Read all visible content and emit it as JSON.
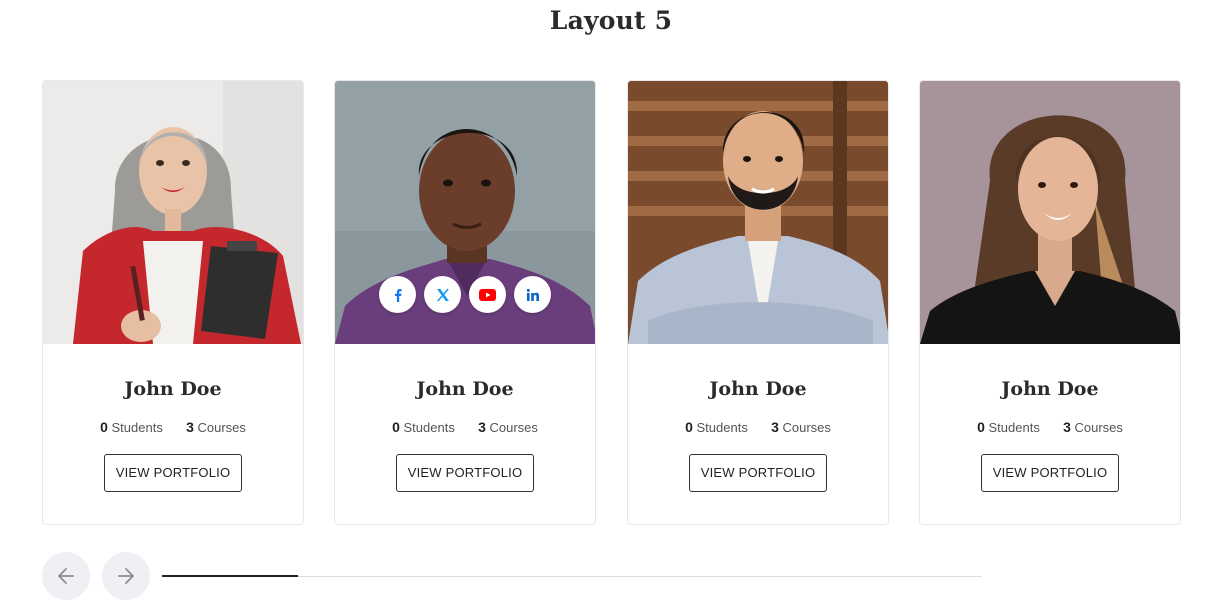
{
  "section": {
    "title": "Layout 5"
  },
  "cards": [
    {
      "name": "John Doe",
      "students": "0",
      "students_label": "Students",
      "courses": "3",
      "courses_label": "Courses",
      "button_label": "VIEW PORTFOLIO"
    },
    {
      "name": "John Doe",
      "students": "0",
      "students_label": "Students",
      "courses": "3",
      "courses_label": "Courses",
      "button_label": "VIEW PORTFOLIO"
    },
    {
      "name": "John Doe",
      "students": "0",
      "students_label": "Students",
      "courses": "3",
      "courses_label": "Courses",
      "button_label": "VIEW PORTFOLIO"
    },
    {
      "name": "John Doe",
      "students": "0",
      "students_label": "Students",
      "courses": "3",
      "courses_label": "Courses",
      "button_label": "VIEW PORTFOLIO"
    }
  ],
  "socials": [
    "facebook-icon",
    "x-icon",
    "youtube-icon",
    "linkedin-icon"
  ],
  "slider": {
    "prev_icon": "arrow-left-icon",
    "next_icon": "arrow-right-icon",
    "progress": 0.166
  },
  "colors": {
    "facebook": "#1877f2",
    "x": "#1d9bf0",
    "youtube": "#ff0000",
    "linkedin": "#0a66c2"
  }
}
